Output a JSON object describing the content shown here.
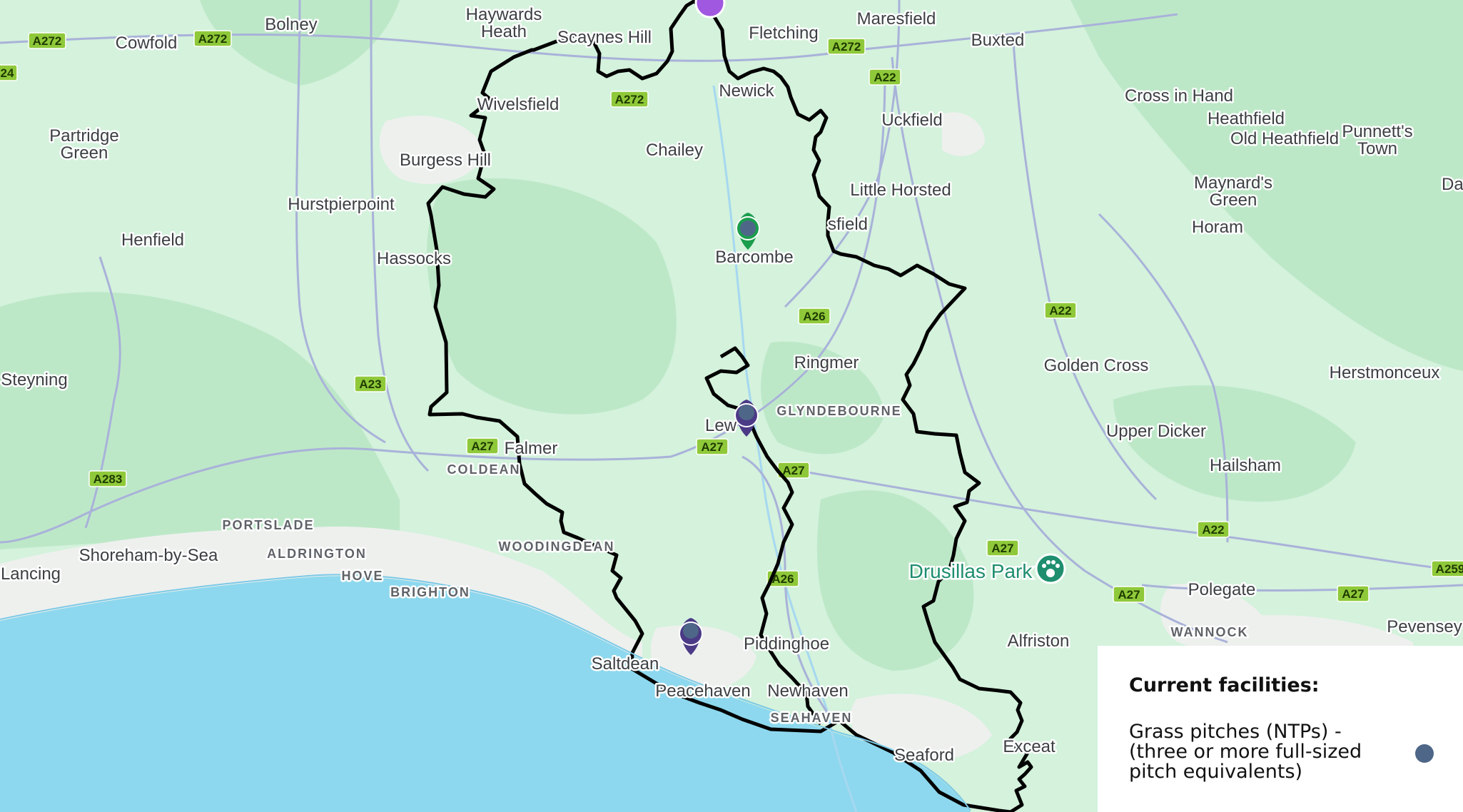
{
  "map": {
    "places": [
      {
        "id": "haywards-heath-1",
        "label": "Haywards"
      },
      {
        "id": "haywards-heath-2",
        "label": "Heath"
      },
      {
        "id": "scaynes-hill",
        "label": "Scaynes Hill"
      },
      {
        "id": "fletching",
        "label": "Fletching"
      },
      {
        "id": "maresfield",
        "label": "Maresfield"
      },
      {
        "id": "buxted",
        "label": "Buxted"
      },
      {
        "id": "bolney",
        "label": "Bolney"
      },
      {
        "id": "cowfold",
        "label": "Cowfold"
      },
      {
        "id": "newick",
        "label": "Newick"
      },
      {
        "id": "wivelsfield",
        "label": "Wivelsfield"
      },
      {
        "id": "partridge-green-1",
        "label": "Partridge"
      },
      {
        "id": "partridge-green-2",
        "label": "Green"
      },
      {
        "id": "chailey",
        "label": "Chailey"
      },
      {
        "id": "uckfield",
        "label": "Uckfield"
      },
      {
        "id": "cross-in-hand",
        "label": "Cross in Hand"
      },
      {
        "id": "heathfield",
        "label": "Heathfield"
      },
      {
        "id": "old-heathfield",
        "label": "Old Heathfield"
      },
      {
        "id": "punnetts-town-1",
        "label": "Punnett's"
      },
      {
        "id": "punnetts-town-2",
        "label": "Town"
      },
      {
        "id": "burgess-hill",
        "label": "Burgess Hill"
      },
      {
        "id": "hurstpierpoint",
        "label": "Hurstpierpoint"
      },
      {
        "id": "little-horsted",
        "label": "Little Horsted"
      },
      {
        "id": "maynards-green-1",
        "label": "Maynard's"
      },
      {
        "id": "maynards-green-2",
        "label": "Green"
      },
      {
        "id": "dallington",
        "label": "Dalling"
      },
      {
        "id": "isfield",
        "label": "sfield"
      },
      {
        "id": "horam",
        "label": "Horam"
      },
      {
        "id": "henfield",
        "label": "Henfield"
      },
      {
        "id": "hassocks",
        "label": "Hassocks"
      },
      {
        "id": "barcombe",
        "label": "Barcombe"
      },
      {
        "id": "ringmer",
        "label": "Ringmer"
      },
      {
        "id": "golden-cross",
        "label": "Golden Cross"
      },
      {
        "id": "herstmonceux",
        "label": "Herstmonceux"
      },
      {
        "id": "steyning",
        "label": "Steyning"
      },
      {
        "id": "lewes",
        "label": "Lew"
      },
      {
        "id": "upper-dicker",
        "label": "Upper Dicker"
      },
      {
        "id": "falmer",
        "label": "Falmer"
      },
      {
        "id": "hailsham",
        "label": "Hailsham"
      },
      {
        "id": "shoreham",
        "label": "Shoreham-by-Sea"
      },
      {
        "id": "lancing",
        "label": "Lancing"
      },
      {
        "id": "polegate",
        "label": "Polegate"
      },
      {
        "id": "pevensey",
        "label": "Pevensey"
      },
      {
        "id": "alfriston",
        "label": "Alfriston"
      },
      {
        "id": "piddinghoe",
        "label": "Piddinghoe"
      },
      {
        "id": "saltdean",
        "label": "Saltdean"
      },
      {
        "id": "peacehaven",
        "label": "Peacehaven"
      },
      {
        "id": "newhaven",
        "label": "Newhaven"
      },
      {
        "id": "seaford",
        "label": "Seaford"
      },
      {
        "id": "exceat",
        "label": "Exceat"
      }
    ],
    "districts": [
      {
        "id": "glyndebourne",
        "label": "GLYNDEBOURNE"
      },
      {
        "id": "coldean",
        "label": "COLDEAN"
      },
      {
        "id": "portslade",
        "label": "PORTSLADE"
      },
      {
        "id": "aldrington",
        "label": "ALDRINGTON"
      },
      {
        "id": "hove",
        "label": "HOVE"
      },
      {
        "id": "brighton",
        "label": "BRIGHTON"
      },
      {
        "id": "woodingdean",
        "label": "WOODINGDEAN"
      },
      {
        "id": "wannock",
        "label": "WANNOCK"
      },
      {
        "id": "seahaven",
        "label": "SEAHAVEN"
      }
    ],
    "road_badges": [
      {
        "id": "a272-w",
        "label": "A272"
      },
      {
        "id": "a272-cowfold",
        "label": "A272"
      },
      {
        "id": "a272-chailey",
        "label": "A272"
      },
      {
        "id": "a272-maresfield",
        "label": "A272"
      },
      {
        "id": "a22-uckfield",
        "label": "A22"
      },
      {
        "id": "a22-golden",
        "label": "A22"
      },
      {
        "id": "a22-hailsham",
        "label": "A22"
      },
      {
        "id": "a26-ringmer",
        "label": "A26"
      },
      {
        "id": "a26-south",
        "label": "A26"
      },
      {
        "id": "a23",
        "label": "A23"
      },
      {
        "id": "a27-falmer",
        "label": "A27"
      },
      {
        "id": "a27-lewes",
        "label": "A27"
      },
      {
        "id": "a27-glynde",
        "label": "A27"
      },
      {
        "id": "a27-drusillas",
        "label": "A27"
      },
      {
        "id": "a27-polegate",
        "label": "A27"
      },
      {
        "id": "a27-east",
        "label": "A27"
      },
      {
        "id": "a283",
        "label": "A283"
      },
      {
        "id": "a259",
        "label": "A259"
      },
      {
        "id": "a24",
        "label": "24"
      }
    ],
    "poi": {
      "label": "Drusillas Park",
      "icon": "paw-icon",
      "color": "#1e8e6e"
    },
    "markers": [
      {
        "id": "barcombe",
        "color": "#1a9d4c",
        "dot": "#4e6788"
      },
      {
        "id": "lewes",
        "color": "#4b3a86",
        "dot": "#4e6788"
      },
      {
        "id": "peacehaven",
        "color": "#4b3a86",
        "dot": "#4e6788"
      }
    ]
  },
  "legend": {
    "title": "Current facilities:",
    "item_label": "Grass pitches (NTPs) - (three or more full-sized pitch equivalents)",
    "item_color": "#4e6788"
  }
}
